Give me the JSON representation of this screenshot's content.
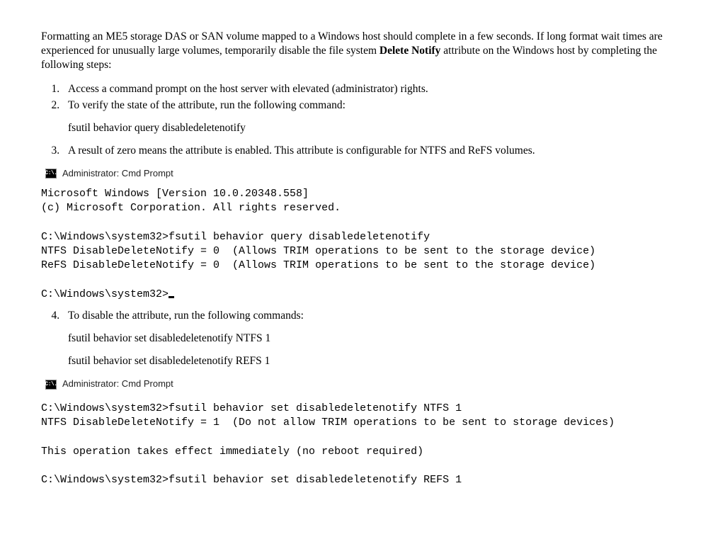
{
  "intro": {
    "part1": "Formatting an ME5 storage DAS or SAN volume mapped to a Windows host should complete in a few seconds. If long format wait times are experienced for unusually large volumes, temporarily disable the file system ",
    "bold": "Delete Notify",
    "part2": " attribute on the Windows host by completing the following steps:"
  },
  "steps": {
    "s1": "Access a command prompt on the host server with elevated (administrator) rights.",
    "s2": "To verify the state of the attribute, run the following command:",
    "s2_cmd": "fsutil behavior query disabledeletenotify",
    "s3": "A result of zero means the attribute is enabled. This attribute is configurable for NTFS and ReFS volumes.",
    "s4": "To disable the attribute, run the following commands:",
    "s4_cmd1": "fsutil behavior set disabledeletenotify NTFS 1",
    "s4_cmd2": "fsutil behavior set disabledeletenotify REFS 1"
  },
  "term1": {
    "icon": "C:\\.",
    "title": "Administrator: Cmd Prompt",
    "l1": "Microsoft Windows [Version 10.0.20348.558]",
    "l2": "(c) Microsoft Corporation. All rights reserved.",
    "l3": "",
    "l4": "C:\\Windows\\system32>fsutil behavior query disabledeletenotify",
    "l5": "NTFS DisableDeleteNotify = 0  (Allows TRIM operations to be sent to the storage device)",
    "l6": "ReFS DisableDeleteNotify = 0  (Allows TRIM operations to be sent to the storage device)",
    "l7": "",
    "l8": "C:\\Windows\\system32>"
  },
  "term2": {
    "icon": "C:\\.",
    "title": "Administrator: Cmd Prompt",
    "l1": "",
    "l2": "C:\\Windows\\system32>fsutil behavior set disabledeletenotify NTFS 1",
    "l3": "NTFS DisableDeleteNotify = 1  (Do not allow TRIM operations to be sent to storage devices)",
    "l4": "",
    "l5": "This operation takes effect immediately (no reboot required)",
    "l6": "",
    "l7": "C:\\Windows\\system32>fsutil behavior set disabledeletenotify REFS 1"
  }
}
